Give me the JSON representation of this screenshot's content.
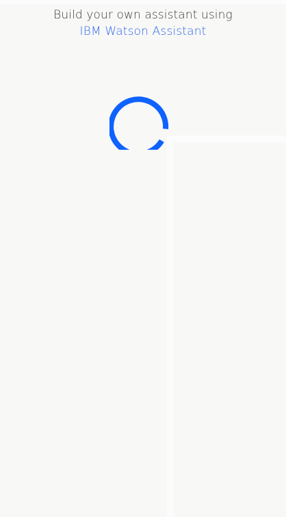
{
  "header": {
    "intro_text": "Build your own assistant using",
    "link_text": "IBM Watson Assistant"
  },
  "loading_spinner": {
    "icon": "loading-spinner-icon",
    "color": "#0f62fe"
  }
}
